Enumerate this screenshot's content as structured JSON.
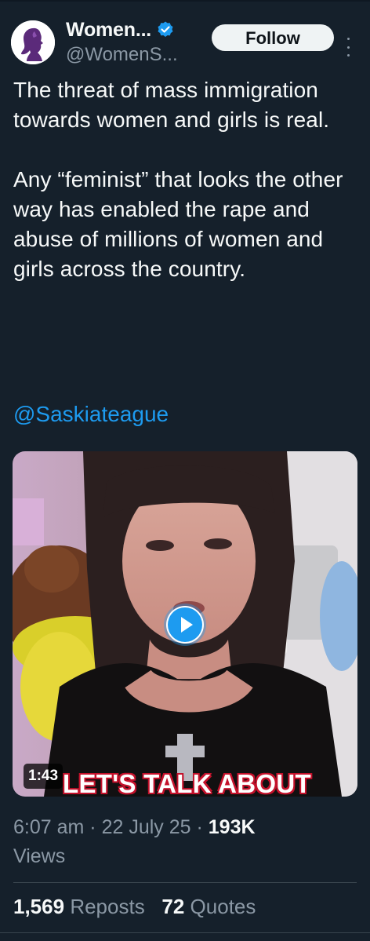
{
  "author": {
    "name": "Women...",
    "handle": "@WomenS...",
    "verified": true,
    "verified_color": "#1d9bf0",
    "avatar_icon": "woman-profile-logo"
  },
  "follow_label": "Follow",
  "more_icon": "more-vertical-icon",
  "tweet": {
    "paragraph1": "The threat of mass immigration towards women and girls is real.",
    "paragraph2": "Any “feminist” that looks the other way has enabled the rape and abuse of millions of women and girls across the country.",
    "mention": "@Saskiateague"
  },
  "media": {
    "type": "video",
    "duration": "1:43",
    "caption": "LET'S TALK ABOUT",
    "play_icon": "play-icon"
  },
  "meta": {
    "time": "6:07 am",
    "separator": "·",
    "date": "22 July 25",
    "views_count": "193K",
    "views_label": "Views"
  },
  "stats": {
    "reposts_count": "1,569",
    "reposts_label": "Reposts",
    "quotes_count": "72",
    "quotes_label": "Quotes"
  },
  "colors": {
    "background": "#15202b",
    "text": "#f7f9f9",
    "secondary": "#8b98a5",
    "link": "#1d9bf0"
  }
}
